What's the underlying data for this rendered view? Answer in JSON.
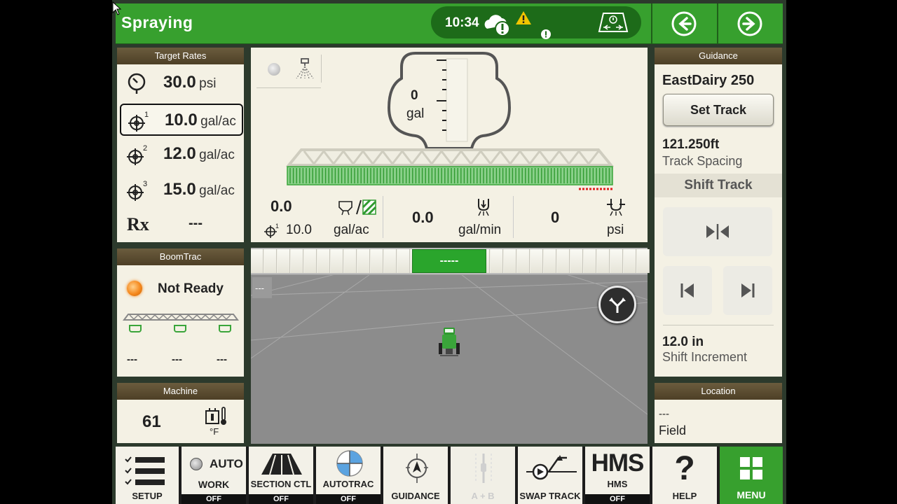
{
  "header": {
    "title": "Spraying",
    "clock": "10:34"
  },
  "target_rates": {
    "title": "Target Rates",
    "pressure": {
      "value": "30.0",
      "unit": "psi"
    },
    "rates": [
      {
        "index": "1",
        "value": "10.0",
        "unit": "gal/ac",
        "selected": true
      },
      {
        "index": "2",
        "value": "12.0",
        "unit": "gal/ac",
        "selected": false
      },
      {
        "index": "3",
        "value": "15.0",
        "unit": "gal/ac",
        "selected": false
      }
    ],
    "rx": {
      "label": "Rx",
      "value": "---"
    }
  },
  "boomtrac": {
    "title": "BoomTrac",
    "status": "Not Ready",
    "status_color": "#f5891e",
    "heights": [
      "---",
      "---",
      "---"
    ]
  },
  "machine": {
    "title": "Machine",
    "temperature": "61",
    "temperature_unit": "°F"
  },
  "tank": {
    "value": "0",
    "unit": "gal"
  },
  "readouts": {
    "applied_rate": "0.0",
    "target_rate": "10.0",
    "target_index": "1",
    "rate_unit": "gal/ac",
    "flow_value": "0.0",
    "flow_unit": "gal/min",
    "pressure_value": "0",
    "pressure_unit": "psi"
  },
  "sections_bar": {
    "center_label": "-----",
    "section_count": 30,
    "center_color": "#2aa52c"
  },
  "map": {
    "offset_label": "---"
  },
  "guidance": {
    "title": "Guidance",
    "track_name": "EastDairy 250",
    "set_track_label": "Set Track",
    "track_spacing_value": "121.250ft",
    "track_spacing_label": "Track Spacing",
    "shift_track_label": "Shift Track",
    "shift_increment_value": "12.0 in",
    "shift_increment_label": "Shift Increment"
  },
  "location": {
    "title": "Location",
    "value": "---",
    "label": "Field"
  },
  "bottom_bar": {
    "setup": "SETUP",
    "work_auto": "AUTO",
    "work": "WORK",
    "work_state": "OFF",
    "section_ctl": "SECTION CTL",
    "section_ctl_state": "OFF",
    "autotrac": "AUTOTRAC",
    "autotrac_state": "OFF",
    "guidance": "GUIDANCE",
    "ab": "A + B",
    "swap_track": "SWAP TRACK",
    "hms_big": "HMS",
    "hms": "HMS",
    "hms_state": "OFF",
    "help": "HELP",
    "menu": "MENU"
  },
  "colors": {
    "accent_green": "#37a02e",
    "dark_green": "#1d6b19",
    "panel_bg": "#f4f1e4",
    "panel_header": "#5b4c30",
    "warning_yellow": "#f2c500"
  }
}
